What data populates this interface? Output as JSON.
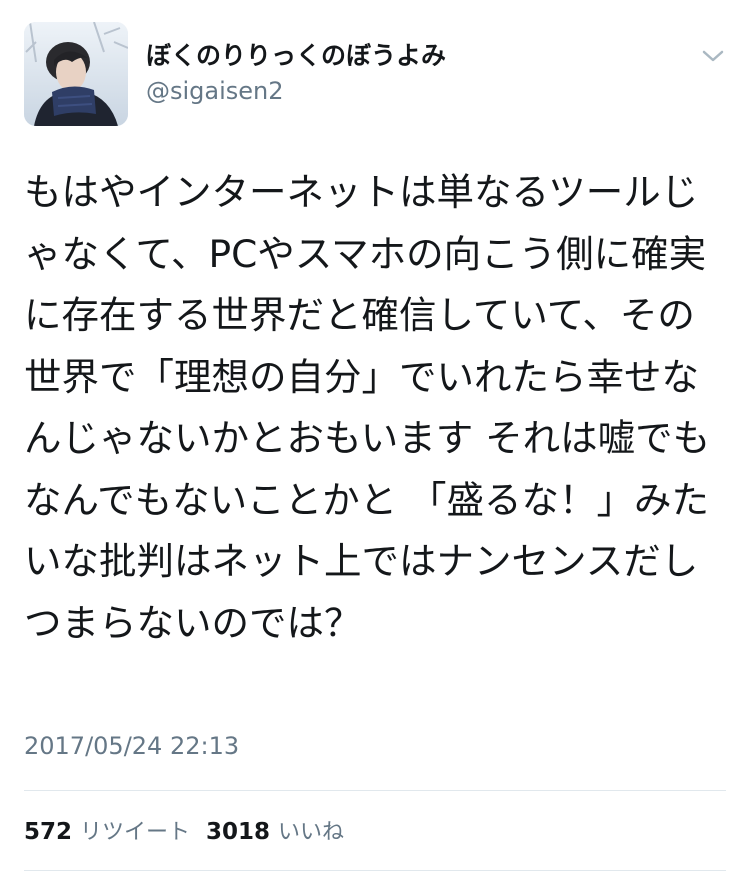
{
  "tweet": {
    "author": {
      "display_name": "ぼくのりりっくのぼうよみ",
      "handle": "@sigaisen2",
      "avatar_icon": "user-avatar-photo"
    },
    "menu_icon": "chevron-down-icon",
    "text": "もはやインターネットは単なるツールじゃなくて、PCやスマホの向こう側に確実に存在する世界だと確信していて、その世界で「理想の自分」でいれたら幸せなんじゃないかとおもいます それは嘘でもなんでもないことかと 「盛るな！」みたいな批判はネット上ではナンセンスだしつまらないのでは？",
    "timestamp": "2017/05/24 22:13",
    "stats": {
      "retweets": {
        "count": "572",
        "label": "リツイート"
      },
      "likes": {
        "count": "3018",
        "label": "いいね"
      }
    }
  },
  "colors": {
    "text_primary": "#14171a",
    "text_secondary": "#657786",
    "divider": "#e1e8ed",
    "background": "#ffffff"
  }
}
